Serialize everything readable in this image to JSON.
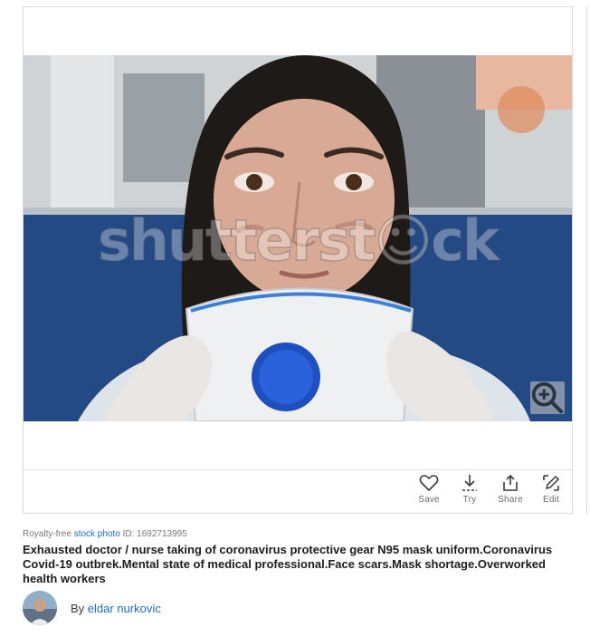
{
  "image": {
    "watermark": "shutterst☺ck",
    "zoom_icon": "zoom-in-icon"
  },
  "actions": [
    {
      "label": "Save",
      "icon": "heart-icon"
    },
    {
      "label": "Try",
      "icon": "download-icon"
    },
    {
      "label": "Share",
      "icon": "share-icon"
    },
    {
      "label": "Edit",
      "icon": "edit-icon"
    }
  ],
  "meta": {
    "license": "Royalty-free",
    "type": "stock photo",
    "id": "ID: 1692713995"
  },
  "title": "Exhausted doctor / nurse taking of coronavirus protective gear N95 mask uniform.Coronavirus Covid-19 outbrek.Mental state of medical professional.Face scars.Mask shortage.Overworked health workers",
  "author": {
    "prefix": "By",
    "name": "eldar nurkovic"
  },
  "colors": {
    "link": "#1e6bb8",
    "mask_valve": "#1f4fbf"
  }
}
